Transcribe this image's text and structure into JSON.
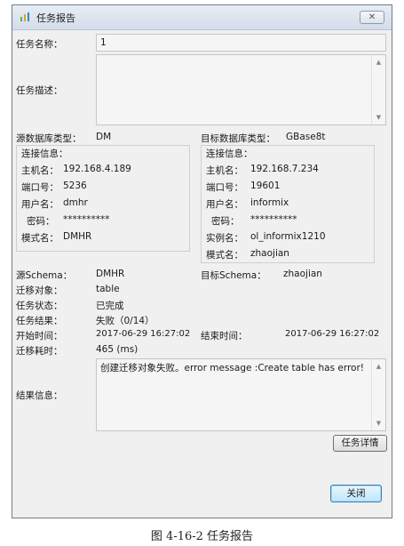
{
  "window": {
    "title": "任务报告",
    "close_glyph": "✕",
    "icon": "report-icon"
  },
  "task": {
    "name_label": "任务名称：",
    "name_value": "1",
    "desc_label": "任务描述：",
    "desc_value": ""
  },
  "source": {
    "type_label": "源数据库类型：",
    "type_value": "DM",
    "conn_label": "连接信息：",
    "host_label": "主机名：",
    "host_value": "192.168.4.189",
    "port_label": "端口号：",
    "port_value": "5236",
    "user_label": "用户名：",
    "user_value": "dmhr",
    "pwd_label": "密码：",
    "pwd_value": "**********",
    "schema_mode_label": "模式名：",
    "schema_mode_value": "DMHR"
  },
  "target": {
    "type_label": "目标数据库类型：",
    "type_value": "GBase8t",
    "conn_label": "连接信息：",
    "host_label": "主机名：",
    "host_value": "192.168.7.234",
    "port_label": "端口号：",
    "port_value": "19601",
    "user_label": "用户名：",
    "user_value": "informix",
    "pwd_label": "密码：",
    "pwd_value": "**********",
    "instance_label": "实例名：",
    "instance_value": "ol_informix1210",
    "schema_mode_label": "模式名：",
    "schema_mode_value": "zhaojian"
  },
  "summary": {
    "src_schema_label": "源Schema：",
    "src_schema_value": "DMHR",
    "tgt_schema_label": "目标Schema：",
    "tgt_schema_value": "zhaojian",
    "object_label": "迁移对象：",
    "object_value": "table",
    "status_label": "任务状态：",
    "status_value": "已完成",
    "result_label": "任务结果：",
    "result_value": "失败（0/14）",
    "start_label": "开始时间：",
    "start_value": "2017-06-29 16:27:02",
    "end_label": "结束时间：",
    "end_value": "2017-06-29 16:27:02",
    "duration_label": "迁移耗时：",
    "duration_value": "465 (ms)",
    "message_label": "结果信息：",
    "message_value": "创建迁移对象失败。error message :Create table has error!"
  },
  "buttons": {
    "details": "任务详情",
    "close": "关闭"
  },
  "caption": "图 4-16-2 任务报告"
}
